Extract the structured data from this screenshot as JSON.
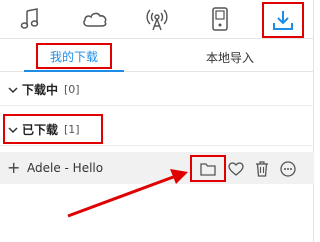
{
  "top_icons": [
    {
      "name": "music-note-icon"
    },
    {
      "name": "cloud-icon"
    },
    {
      "name": "radio-icon"
    },
    {
      "name": "device-icon"
    },
    {
      "name": "download-icon",
      "active": true
    }
  ],
  "tabs": {
    "my_downloads": "我的下载",
    "local_import": "本地导入"
  },
  "groups": {
    "downloading": {
      "title": "下载中",
      "count": "[0]"
    },
    "downloaded": {
      "title": "已下载",
      "count": "[1]"
    }
  },
  "songs": [
    {
      "title": "Adele - Hello"
    }
  ],
  "colors": {
    "accent": "#1f8de6",
    "highlight": "#e00000",
    "row_bg": "#f1f1f1"
  }
}
